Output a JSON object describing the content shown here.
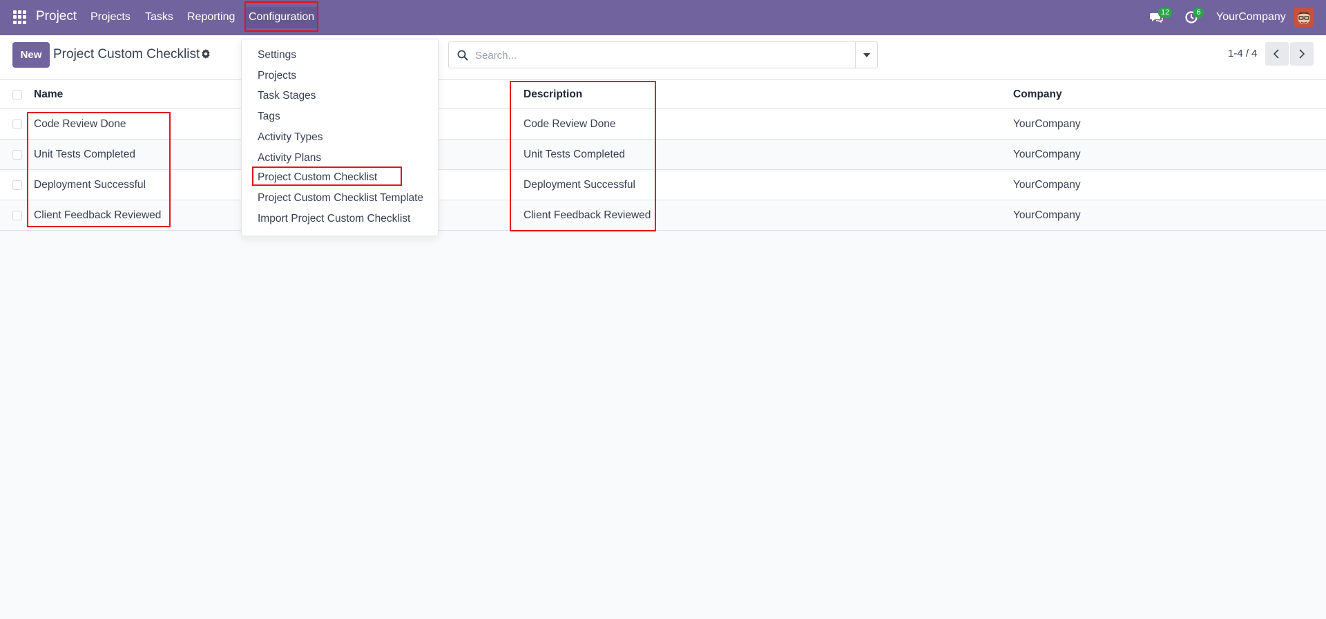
{
  "navbar": {
    "apps_icon": "apps-grid-icon",
    "brand": "Project",
    "menu": [
      {
        "label": "Projects"
      },
      {
        "label": "Tasks"
      },
      {
        "label": "Reporting"
      },
      {
        "label": "Configuration"
      }
    ],
    "messages_badge": "12",
    "activities_badge": "6",
    "company": "YourCompany",
    "color": "#71639e"
  },
  "control": {
    "new_label": "New",
    "title": "Project Custom Checklist",
    "search_placeholder": "Search...",
    "pager": "1-4 / 4"
  },
  "dropdown": {
    "items": [
      {
        "label": "Settings"
      },
      {
        "label": "Projects"
      },
      {
        "label": "Task Stages"
      },
      {
        "label": "Tags"
      },
      {
        "label": "Activity Types"
      },
      {
        "label": "Activity Plans"
      },
      {
        "label": "Project Custom Checklist"
      },
      {
        "label": "Project Custom Checklist Template"
      },
      {
        "label": "Import Project Custom Checklist"
      }
    ]
  },
  "table": {
    "columns": {
      "name": "Name",
      "description": "Description",
      "company": "Company"
    },
    "rows": [
      {
        "name": "Code Review Done",
        "description": "Code Review Done",
        "company": "YourCompany"
      },
      {
        "name": "Unit Tests Completed",
        "description": "Unit Tests Completed",
        "company": "YourCompany"
      },
      {
        "name": "Deployment Successful",
        "description": "Deployment Successful",
        "company": "YourCompany"
      },
      {
        "name": "Client Feedback Reviewed",
        "description": "Client Feedback Reviewed",
        "company": "YourCompany"
      }
    ]
  },
  "colors": {
    "highlight": "#e3131d",
    "badge": "#28a745"
  }
}
